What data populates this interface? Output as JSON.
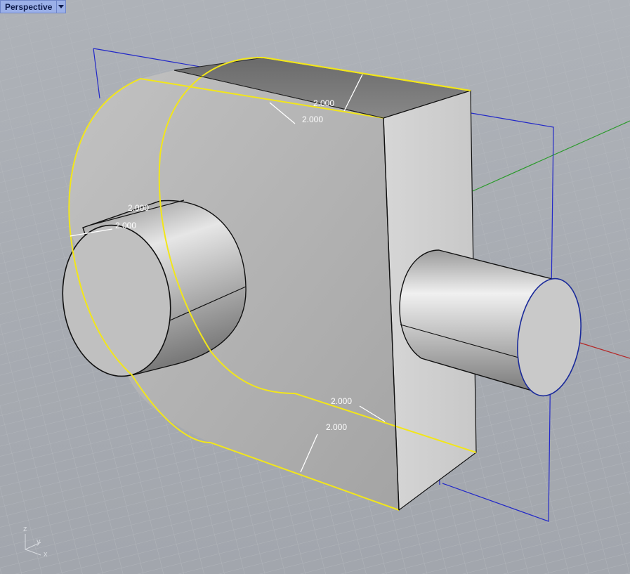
{
  "viewport": {
    "name": "Perspective"
  },
  "dimensions": {
    "top_outer": "2.000",
    "top_inner": "2.000",
    "cyl_left_a": "2.000",
    "cyl_left_b": "2.000",
    "bottom_a": "2.000",
    "bottom_b": "2.000"
  },
  "axes": {
    "z": "z",
    "y": "y",
    "x": "x"
  },
  "colors": {
    "background": "#a9adb4",
    "selection": "#f2e61a",
    "cplane": "#2228c8",
    "x_axis": "#b42828",
    "y_axis": "#2a9a2a"
  }
}
